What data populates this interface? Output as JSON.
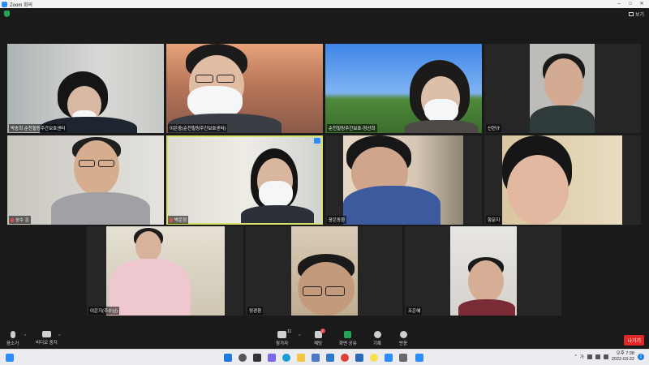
{
  "window": {
    "title": "Zoom 회의",
    "controls": [
      "–",
      "□",
      "✕"
    ]
  },
  "topbar": {
    "view_label": "보기"
  },
  "participants": [
    {
      "name": "박송희 순천힐링주간보호센터",
      "muted": false,
      "active": false
    },
    {
      "name": "이은중(순천힐링주간보호센터)",
      "muted": false,
      "active": false
    },
    {
      "name": "순천힐링주간보호-정선희",
      "muted": false,
      "active": false
    },
    {
      "name": "신현규",
      "muted": false,
      "active": false
    },
    {
      "name": "상수 김",
      "muted": true,
      "active": false
    },
    {
      "name": "박은정",
      "muted": true,
      "active": true
    },
    {
      "name": "윤은동환",
      "muted": false,
      "active": false
    },
    {
      "name": "함문지",
      "muted": false,
      "active": false
    },
    {
      "name": "이은지(주수님)",
      "muted": false,
      "active": false
    },
    {
      "name": "정경환",
      "muted": false,
      "active": false
    },
    {
      "name": "조은혜",
      "muted": false,
      "active": false
    }
  ],
  "toolbar": {
    "audio_label": "음소거",
    "video_label": "비디오 중지",
    "participants_label": "참가자",
    "participants_count": "11",
    "chat_label": "채팅",
    "chat_badge": "2",
    "share_label": "화면 공유",
    "record_label": "기록",
    "reactions_label": "반응",
    "leave_label": "나가기"
  },
  "taskbar": {
    "lang": "가",
    "time": "오후 7:38",
    "date": "2022-03-22",
    "icons": [
      "start-icon",
      "search-icon",
      "taskview-icon",
      "chat-icon",
      "edge-icon",
      "explorer-icon",
      "store-icon",
      "mail-icon",
      "chrome-icon",
      "app-icon",
      "kakao-icon",
      "zoom-icon"
    ],
    "notification_count": "1"
  },
  "colors": {
    "accent": "#2d8cff",
    "active_border": "#d8e26a",
    "leave": "#e02828",
    "share": "#23a455"
  }
}
